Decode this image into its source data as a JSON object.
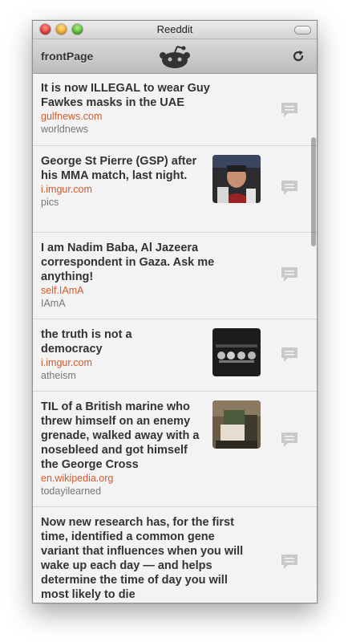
{
  "window": {
    "title": "Reeddit"
  },
  "toolbar": {
    "title": "frontPage",
    "logo_icon": "reddit-alien-icon",
    "refresh_icon": "refresh-icon"
  },
  "posts": [
    {
      "title": "It is now ILLEGAL to wear Guy Fawkes masks in the UAE",
      "domain": "gulfnews.com",
      "subreddit": "worldnews",
      "has_thumbnail": false
    },
    {
      "title": "George St Pierre (GSP) after his MMA match, last night.",
      "domain": "i.imgur.com",
      "subreddit": "pics",
      "has_thumbnail": true
    },
    {
      "title": "I am Nadim Baba, Al Jazeera correspondent in Gaza. Ask me anything!",
      "domain": "self.IAmA",
      "subreddit": "IAmA",
      "has_thumbnail": false
    },
    {
      "title": "the truth is not a democracy",
      "domain": "i.imgur.com",
      "subreddit": "atheism",
      "has_thumbnail": true
    },
    {
      "title": "TIL of a British marine who threw himself on an enemy grenade, walked away with a nosebleed and got himself the George Cross",
      "domain": "en.wikipedia.org",
      "subreddit": "todayilearned",
      "has_thumbnail": true
    },
    {
      "title": "Now new research has, for the first time, identified a common gene variant that influences when you will wake up each day — and helps determine the time of day you will most likely to die",
      "domain": "",
      "subreddit": "",
      "has_thumbnail": false
    }
  ],
  "colors": {
    "domain": "#d35a2a",
    "subreddit": "#777777",
    "title": "#333333"
  }
}
